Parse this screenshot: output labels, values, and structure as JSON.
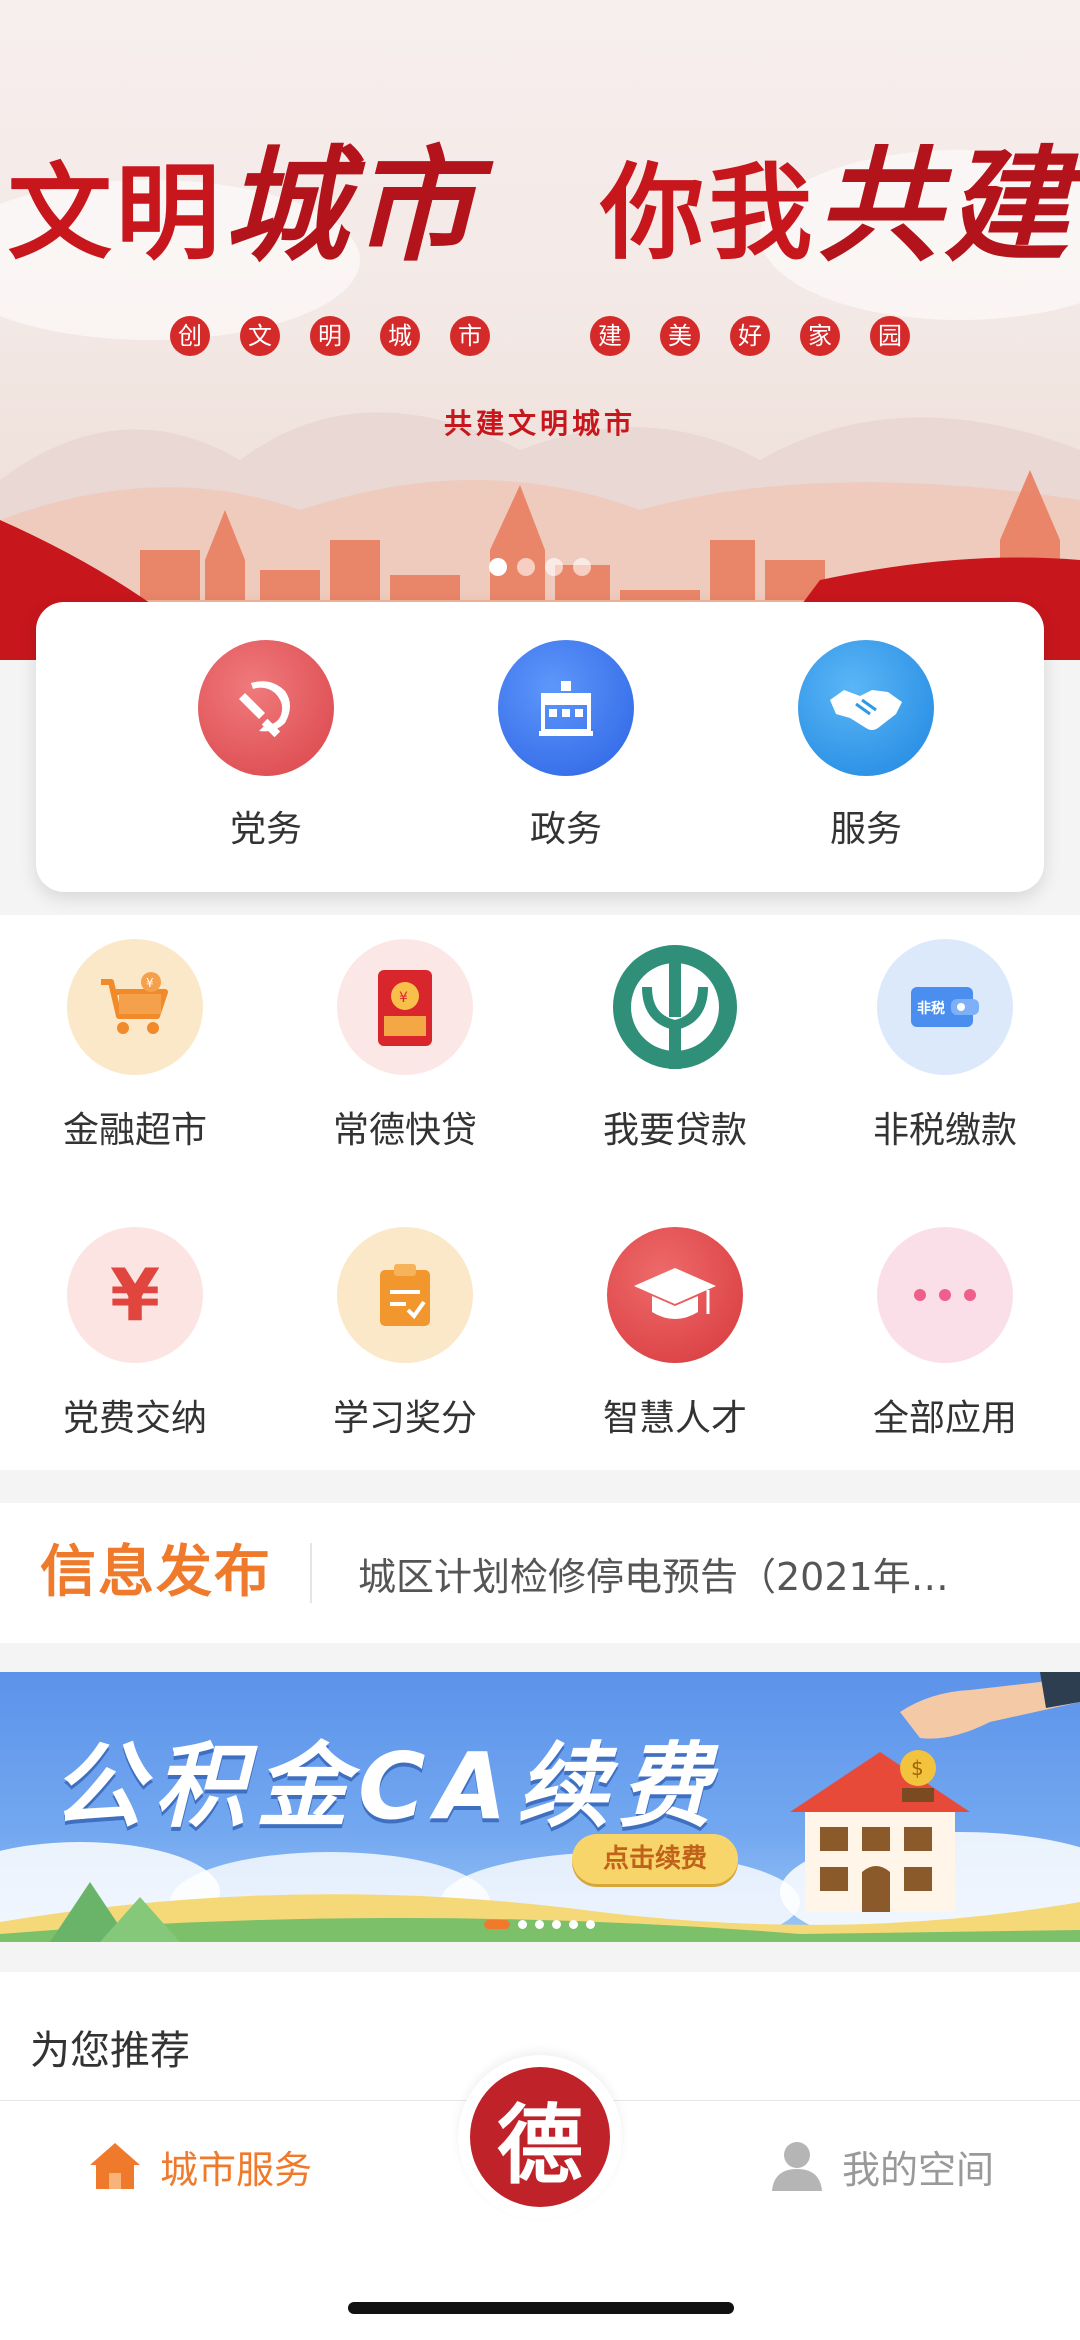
{
  "hero": {
    "title_a": "文明",
    "title_b": "城市",
    "title_c": "你我",
    "title_d": "共建",
    "subtitle_chars_left": [
      "创",
      "文",
      "明",
      "城",
      "市"
    ],
    "subtitle_chars_right": [
      "建",
      "美",
      "好",
      "家",
      "园"
    ],
    "tagline": "共建文明城市",
    "carousel_total": 4,
    "carousel_active": 1
  },
  "main_services": [
    {
      "label": "党务",
      "icon": "hammer-sickle-icon",
      "color": "#e35a5e"
    },
    {
      "label": "政务",
      "icon": "government-building-icon",
      "color": "#3a78ee"
    },
    {
      "label": "服务",
      "icon": "handshake-icon",
      "color": "#2b9be8"
    }
  ],
  "apps": [
    {
      "label": "金融超市",
      "icon": "shopping-cart-icon"
    },
    {
      "label": "常德快贷",
      "icon": "red-envelope-icon"
    },
    {
      "label": "我要贷款",
      "icon": "abc-bank-logo-icon"
    },
    {
      "label": "非税缴款",
      "icon": "wallet-card-icon"
    },
    {
      "label": "党费交纳",
      "icon": "yen-icon"
    },
    {
      "label": "学习奖分",
      "icon": "clipboard-check-icon"
    },
    {
      "label": "智慧人才",
      "icon": "graduation-cap-icon"
    },
    {
      "label": "全部应用",
      "icon": "more-dots-icon"
    }
  ],
  "news": {
    "title": "信息发布",
    "headline": "城区计划检修停电预告（2021年…"
  },
  "promo": {
    "title": "公积金CA续费",
    "button": "点击续费",
    "carousel_total": 6,
    "carousel_active": 1
  },
  "recommend": {
    "title": "为您推荐"
  },
  "tabbar": {
    "left_label": "城市服务",
    "center_char": "德",
    "right_label": "我的空间",
    "active_color": "#f07a2c",
    "inactive_color": "#999999"
  }
}
